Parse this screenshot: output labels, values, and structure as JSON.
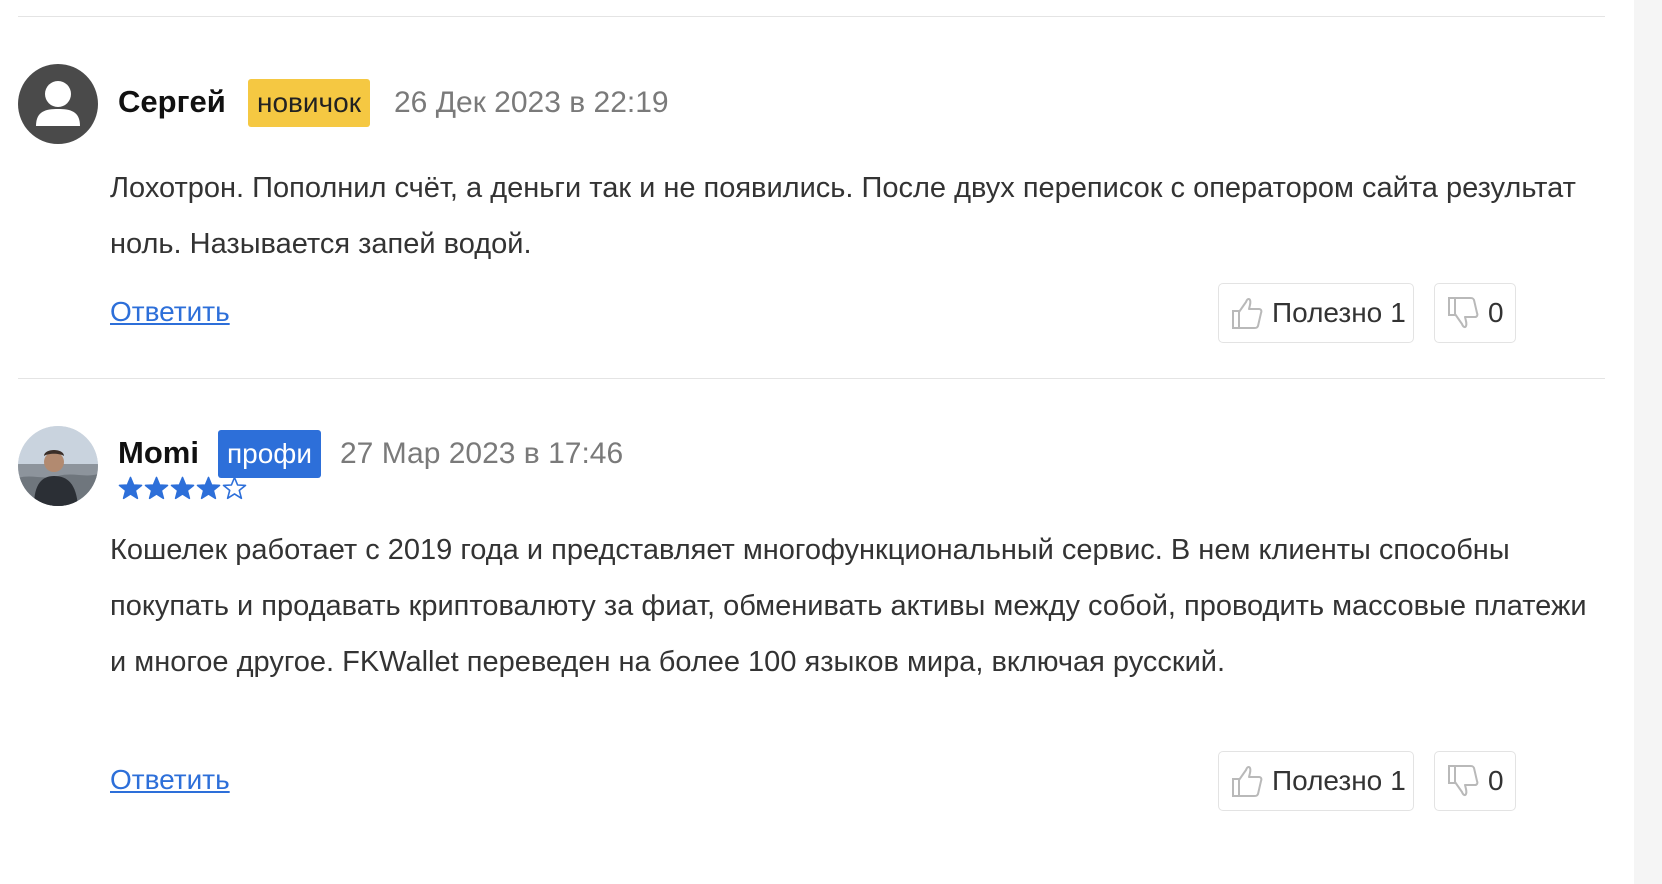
{
  "reviews": [
    {
      "author": "Сергей",
      "badge": "новичок",
      "date": "26 Дек 2023 в 22:19",
      "text": "Лохотрон. Пополнил счёт, а деньги так и не появились. После двух переписок с оператором сайта результат ноль. Называется запей водой.",
      "reply_label": "Ответить",
      "helpful_label": "Полезно",
      "helpful_count": "1",
      "unhelpful_count": "0"
    },
    {
      "author": "Momi",
      "badge": "профи",
      "date": "27 Мар 2023 в 17:46",
      "rating": 4,
      "rating_max": 5,
      "text": "Кошелек работает с 2019 года и представляет многофункциональный сервис. В нем клиенты способны покупать и продавать криптовалюту за фиат, обменивать активы между собой, проводить массовые платежи и многое другое. FKWallet переведен на более 100 языков мира, включая русский.",
      "reply_label": "Ответить",
      "helpful_label": "Полезно",
      "helpful_count": "1",
      "unhelpful_count": "0"
    }
  ],
  "colors": {
    "badge_novice": "#f5c842",
    "badge_pro": "#2d6fd9",
    "link": "#2d6fd9",
    "star": "#2d6fd9"
  },
  "icons": {
    "default_avatar": "user-silhouette-icon",
    "helpful": "thumbs-up-icon",
    "unhelpful": "thumbs-down-icon",
    "star_filled": "star-filled-icon",
    "star_empty": "star-outline-icon"
  }
}
